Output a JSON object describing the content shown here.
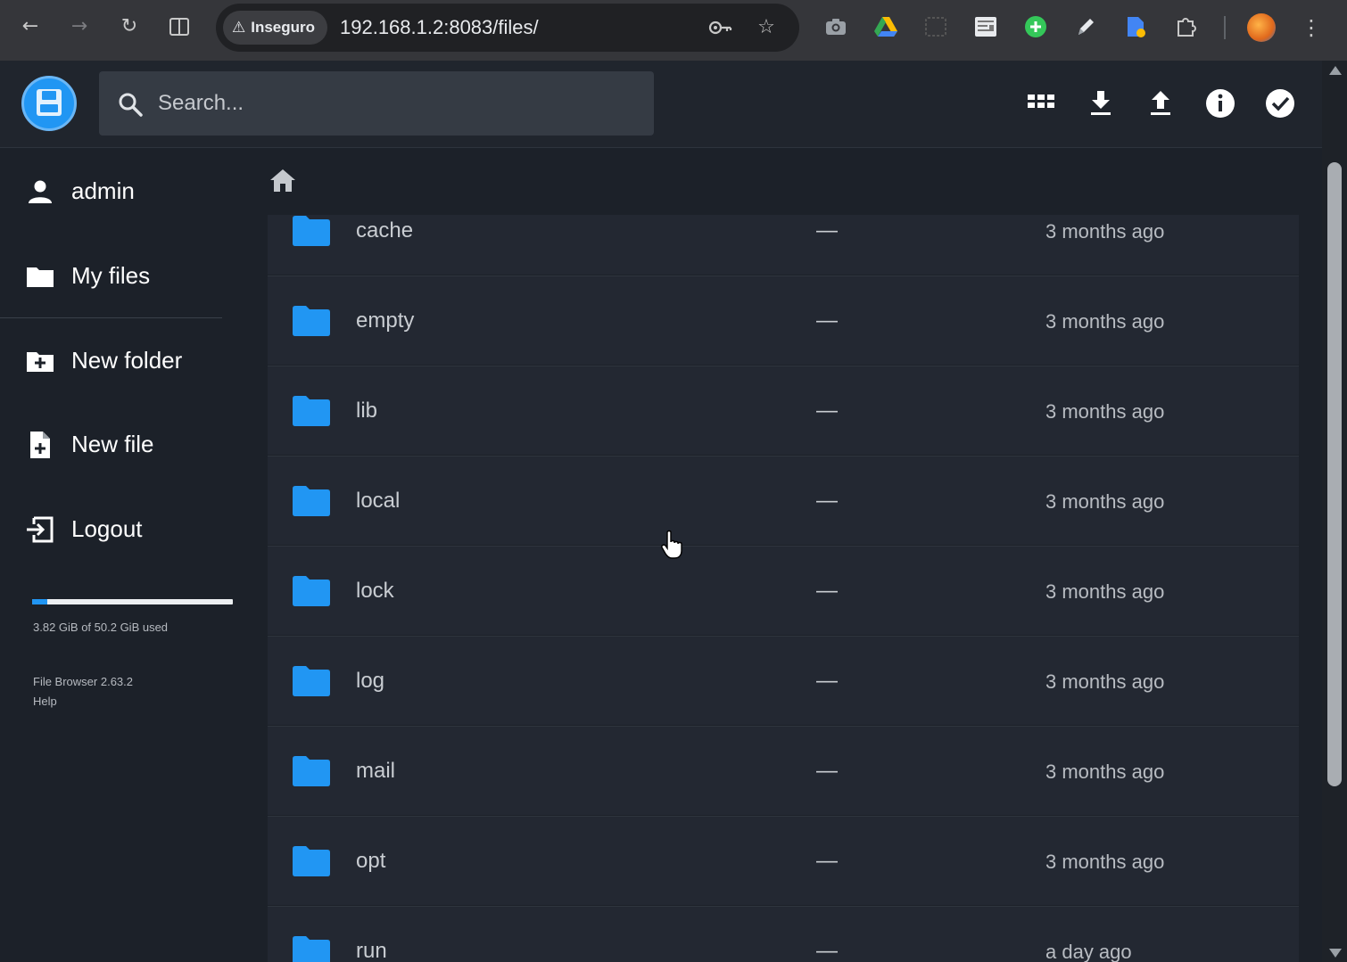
{
  "browser": {
    "security_label": "Inseguro",
    "url": "192.168.1.2:8083/files/",
    "icons": [
      "back-arrow-icon",
      "forward-arrow-icon",
      "reload-icon",
      "split-view-icon",
      "key-icon",
      "star-icon",
      "camera-extension-icon",
      "drive-extension-icon",
      "screenshot-extension-icon",
      "reader-extension-icon",
      "plus-extension-icon",
      "pen-extension-icon",
      "doc-extension-icon",
      "puzzle-extensions-icon",
      "profile-avatar",
      "kebab-menu-icon"
    ]
  },
  "header": {
    "search_placeholder": "Search...",
    "actions": [
      "grid-view-icon",
      "download-icon",
      "upload-icon",
      "info-icon",
      "select-check-icon"
    ]
  },
  "sidebar": {
    "user": "admin",
    "my_files": "My files",
    "new_folder": "New folder",
    "new_file": "New file",
    "logout": "Logout",
    "usage_text": "3.82 GiB of 50.2 GiB used",
    "usage_fraction": 0.076,
    "version": "File Browser 2.63.2",
    "help": "Help"
  },
  "files": [
    {
      "name": "cache",
      "size": "—",
      "modified": "3 months ago"
    },
    {
      "name": "empty",
      "size": "—",
      "modified": "3 months ago"
    },
    {
      "name": "lib",
      "size": "—",
      "modified": "3 months ago"
    },
    {
      "name": "local",
      "size": "—",
      "modified": "3 months ago"
    },
    {
      "name": "lock",
      "size": "—",
      "modified": "3 months ago"
    },
    {
      "name": "log",
      "size": "—",
      "modified": "3 months ago"
    },
    {
      "name": "mail",
      "size": "—",
      "modified": "3 months ago"
    },
    {
      "name": "opt",
      "size": "—",
      "modified": "3 months ago"
    },
    {
      "name": "run",
      "size": "—",
      "modified": "a day ago"
    }
  ],
  "colors": {
    "accent": "#2196f3",
    "background": "#1c2129",
    "row": "#232832",
    "header": "#20252d"
  }
}
